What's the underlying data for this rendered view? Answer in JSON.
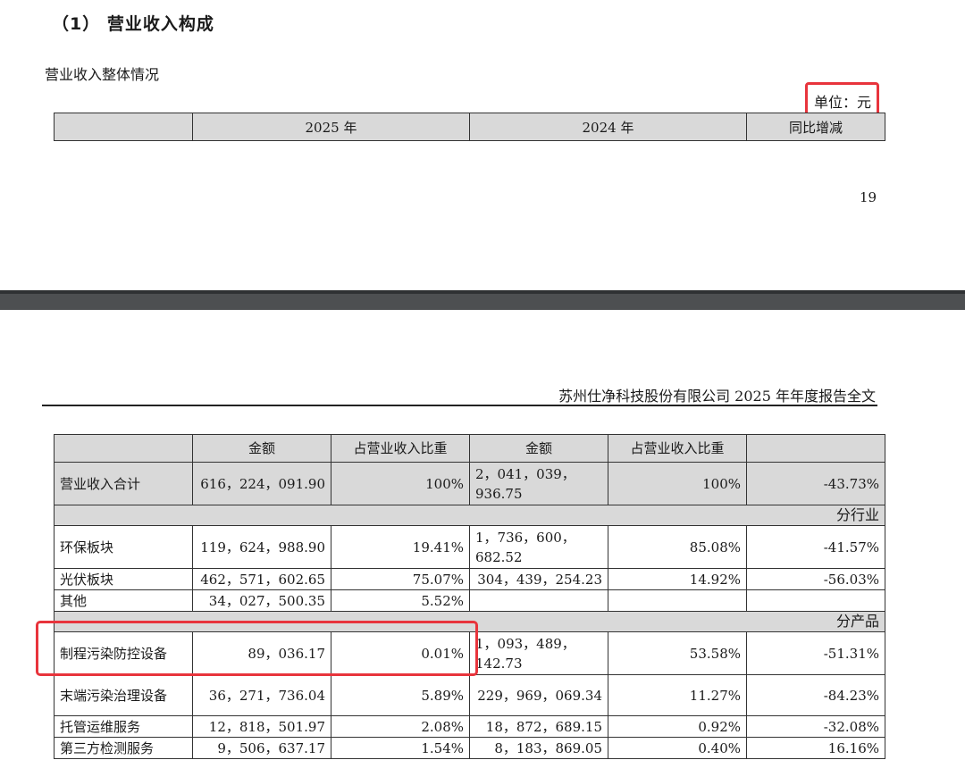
{
  "section_title": "（1）  营业收入构成",
  "overview_label": "营业收入整体情况",
  "unit_label": "单位：元",
  "page_number": "19",
  "report_header": "苏州仕净科技股份有限公司 2025 年年度报告全文",
  "table": {
    "year_headers": [
      "",
      "2025 年",
      "2024 年",
      "同比增减"
    ],
    "sub_headers": [
      "",
      "金额",
      "占营业收入比重",
      "金额",
      "占营业收入比重",
      ""
    ],
    "total_row": [
      "营业收入合计",
      "616，224，091.90",
      "100%",
      "2，041，039，936.75",
      "100%",
      "-43.73%"
    ],
    "industry_label": "分行业",
    "industry_rows": [
      [
        "环保板块",
        "119，624，988.90",
        "19.41%",
        "1，736，600，682.52",
        "85.08%",
        "-41.57%"
      ],
      [
        "光伏板块",
        "462，571，602.65",
        "75.07%",
        "304，439，254.23",
        "14.92%",
        "-56.03%"
      ],
      [
        "其他",
        "34，027，500.35",
        "5.52%",
        "",
        "",
        ""
      ]
    ],
    "product_label": "分产品",
    "product_rows": [
      [
        "制程污染防控设备",
        "89，036.17",
        "0.01%",
        "1，093，489，142.73",
        "53.58%",
        "-51.31%"
      ],
      [
        "末端污染治理设备",
        "36，271，736.04",
        "5.89%",
        "229，969，069.34",
        "11.27%",
        "-84.23%"
      ],
      [
        "托管运维服务",
        "12，818，501.97",
        "2.08%",
        "18，872，689.15",
        "0.92%",
        "-32.08%"
      ],
      [
        "第三方检测服务",
        "9，506，637.17",
        "1.54%",
        "8，183，869.05",
        "0.40%",
        "16.16%"
      ]
    ]
  },
  "colors": {
    "highlight": "#e8343c",
    "header_fill": "#d9d9d9",
    "divider": "#4d4f51"
  }
}
